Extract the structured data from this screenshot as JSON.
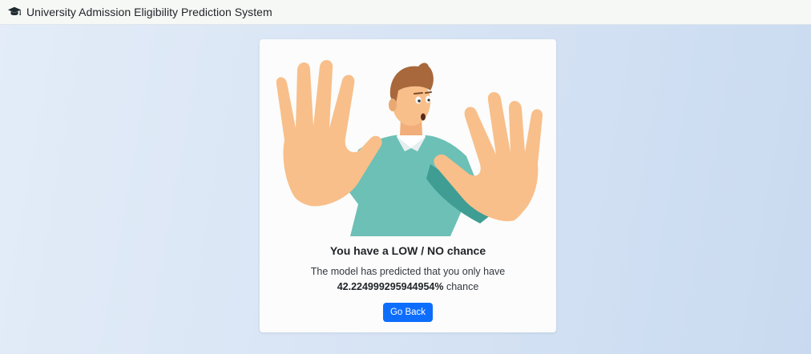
{
  "navbar": {
    "icon": "graduation-cap-icon",
    "title": "University Admission Eligibility Prediction System"
  },
  "result": {
    "illustration": "stop-hands-illustration",
    "heading": "You have a LOW / NO chance",
    "message_prefix": "The model has predicted that you only have",
    "probability_text": "42.224999295944954%",
    "message_suffix": " chance",
    "button_label": "Go Back"
  },
  "colors": {
    "primary_button": "#0d6efd",
    "shirt": "#6cc0b6",
    "skin": "#f8bf8a",
    "hair": "#a8683c"
  }
}
